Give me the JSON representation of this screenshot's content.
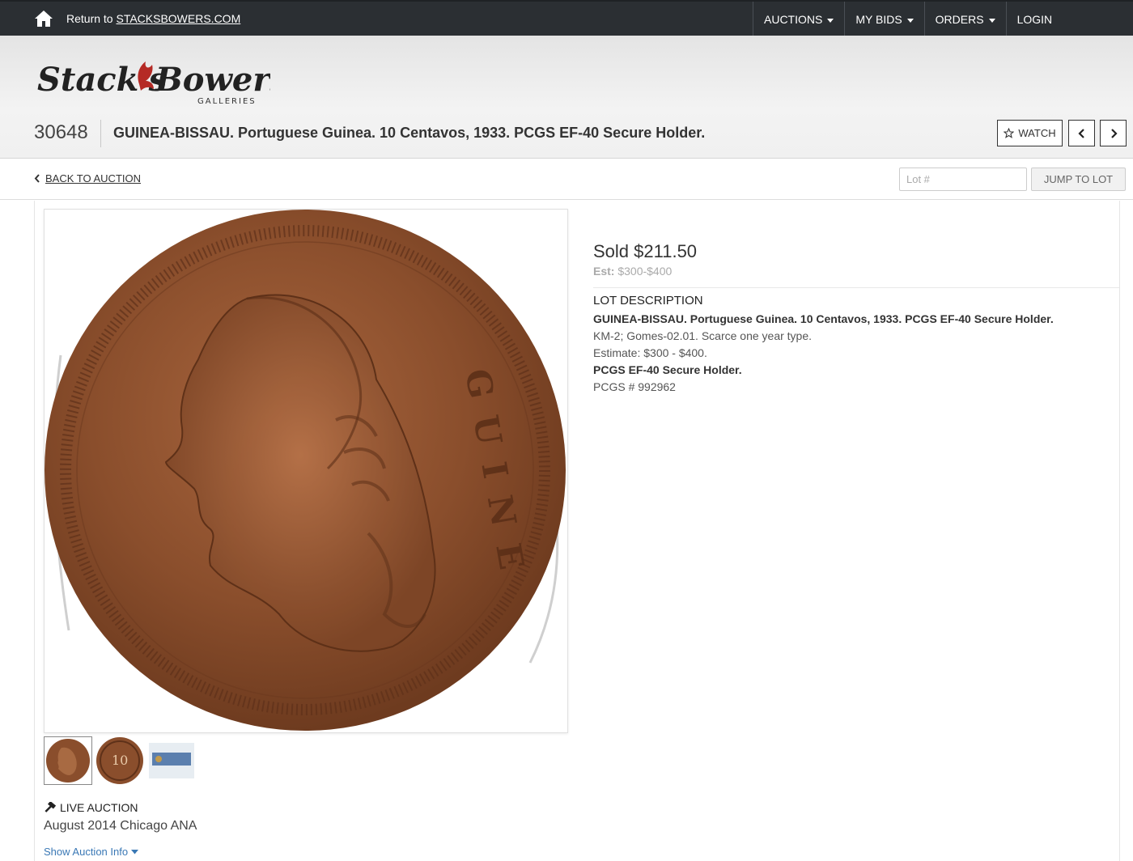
{
  "topbar": {
    "return_prefix": "Return to",
    "return_link": "STACKSBOWERS.COM",
    "nav": [
      {
        "label": "AUCTIONS",
        "dropdown": true
      },
      {
        "label": "MY BIDS",
        "dropdown": true
      },
      {
        "label": "ORDERS",
        "dropdown": true
      },
      {
        "label": "LOGIN",
        "dropdown": false
      }
    ]
  },
  "logo": {
    "name": "Stack's Bowers",
    "tagline": "GALLERIES"
  },
  "lot": {
    "number": "30648",
    "title": "GUINEA-BISSAU. Portuguese Guinea. 10 Centavos, 1933. PCGS EF-40 Secure Holder.",
    "watch_label": "WATCH"
  },
  "subbar": {
    "back_label": "BACK TO AUCTION",
    "lot_placeholder": "Lot #",
    "jump_label": "JUMP TO LOT"
  },
  "coin": {
    "legend": "GUINE"
  },
  "thumbs": [
    "obverse",
    "reverse",
    "slab"
  ],
  "thumb_reverse_value": "10",
  "sale": {
    "price": "Sold $211.50",
    "estimate_label": "Est:",
    "estimate_value": "$300-$400"
  },
  "description": {
    "heading": "LOT DESCRIPTION",
    "title": "GUINEA-BISSAU. Portuguese Guinea. 10 Centavos, 1933. PCGS EF-40 Secure Holder.",
    "line1": "KM-2; Gomes-02.01. Scarce one year type.",
    "line2": "Estimate: $300 - $400.",
    "line3": "PCGS EF-40 Secure Holder.",
    "line4": "PCGS # 992962"
  },
  "auction": {
    "type_label": "LIVE AUCTION",
    "name": "August 2014 Chicago ANA",
    "show_info": "Show Auction Info"
  },
  "colors": {
    "topbar": "#2b2f33",
    "link": "#3a78b5",
    "coin": "#8a4e2c",
    "logo_red": "#c0392b"
  },
  "icons": [
    "home-icon",
    "caret-down-icon",
    "star-icon",
    "chevron-left-icon",
    "chevron-right-icon",
    "gavel-icon"
  ]
}
